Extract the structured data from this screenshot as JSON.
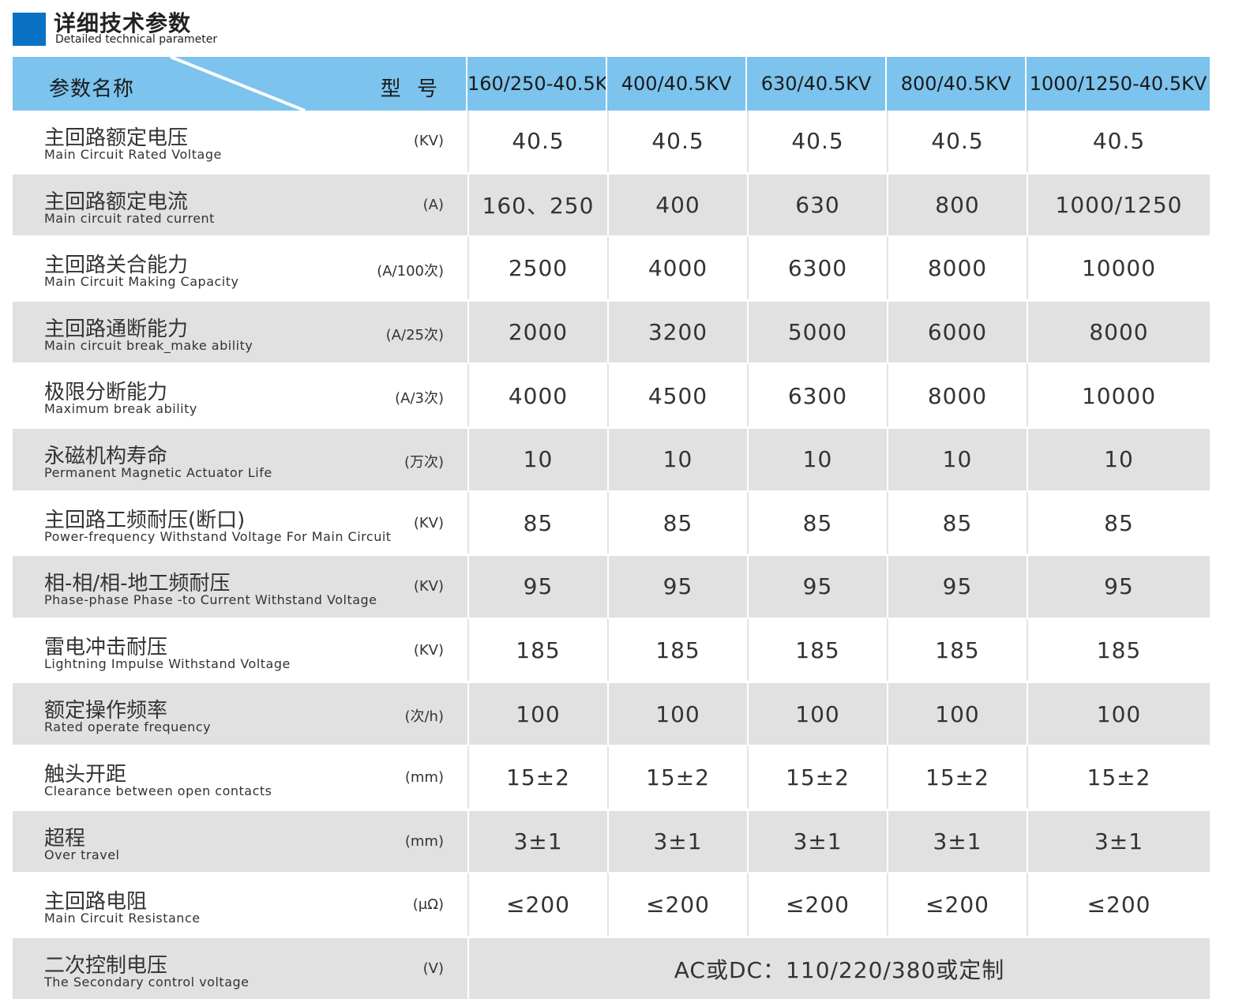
{
  "title": {
    "cn": "详细技术参数",
    "en": "Detailed technical parameter"
  },
  "header": {
    "param_label": "参数名称",
    "model_label": "型 号",
    "models": [
      "160/250-40.5KV",
      "400/40.5KV",
      "630/40.5KV",
      "800/40.5KV",
      "1000/1250-40.5KV"
    ]
  },
  "rows": [
    {
      "cn": "主回路额定电压",
      "en": "Main Circuit Rated Voltage",
      "unit": "(KV)",
      "values": [
        "40.5",
        "40.5",
        "40.5",
        "40.5",
        "40.5"
      ]
    },
    {
      "cn": "主回路额定电流",
      "en": "Main circuit rated current",
      "unit": "(A)",
      "values": [
        "160、250",
        "400",
        "630",
        "800",
        "1000/1250"
      ]
    },
    {
      "cn": "主回路关合能力",
      "en": "Main Circuit Making Capacity",
      "unit": "(A/100次)",
      "values": [
        "2500",
        "4000",
        "6300",
        "8000",
        "10000"
      ]
    },
    {
      "cn": "主回路通断能力",
      "en": "Main circuit break_make ability",
      "unit": "(A/25次)",
      "values": [
        "2000",
        "3200",
        "5000",
        "6000",
        "8000"
      ]
    },
    {
      "cn": "极限分断能力",
      "en": "Maximum break ability",
      "unit": "(A/3次)",
      "values": [
        "4000",
        "4500",
        "6300",
        "8000",
        "10000"
      ]
    },
    {
      "cn": "永磁机构寿命",
      "en": "Permanent Magnetic Actuator Life",
      "unit": "(万次)",
      "values": [
        "10",
        "10",
        "10",
        "10",
        "10"
      ]
    },
    {
      "cn": "主回路工频耐压(断口)",
      "en": "Power-frequency Withstand Voltage For Main Circuit",
      "unit": "(KV)",
      "values": [
        "85",
        "85",
        "85",
        "85",
        "85"
      ]
    },
    {
      "cn": "相-相/相-地工频耐压",
      "en": "Phase-phase  Phase -to Current Withstand Voltage",
      "unit": "(KV)",
      "values": [
        "95",
        "95",
        "95",
        "95",
        "95"
      ]
    },
    {
      "cn": "雷电冲击耐压",
      "en": "Lightning Impulse Withstand Voltage",
      "unit": "(KV)",
      "values": [
        "185",
        "185",
        "185",
        "185",
        "185"
      ]
    },
    {
      "cn": "额定操作频率",
      "en": "Rated operate frequency",
      "unit": "(次/h)",
      "values": [
        "100",
        "100",
        "100",
        "100",
        "100"
      ]
    },
    {
      "cn": "触头开距",
      "en": "Clearance between open contacts",
      "unit": "(mm)",
      "values": [
        "15±2",
        "15±2",
        "15±2",
        "15±2",
        "15±2"
      ]
    },
    {
      "cn": "超程",
      "en": "Over travel",
      "unit": "(mm)",
      "values": [
        "3±1",
        "3±1",
        "3±1",
        "3±1",
        "3±1"
      ]
    },
    {
      "cn": "主回路电阻",
      "en": "Main Circuit Resistance",
      "unit": "(μΩ)",
      "values": [
        "≤200",
        "≤200",
        "≤200",
        "≤200",
        "≤200"
      ]
    }
  ],
  "last_row": {
    "cn": "二次控制电压",
    "en": "The Secondary control voltage",
    "unit": "(V)",
    "value": "AC或DC：110/220/380或定制"
  },
  "colors": {
    "accent": "#0a72c4",
    "header_bg": "#7cc3ee",
    "stripe": "#e1e1e1"
  }
}
